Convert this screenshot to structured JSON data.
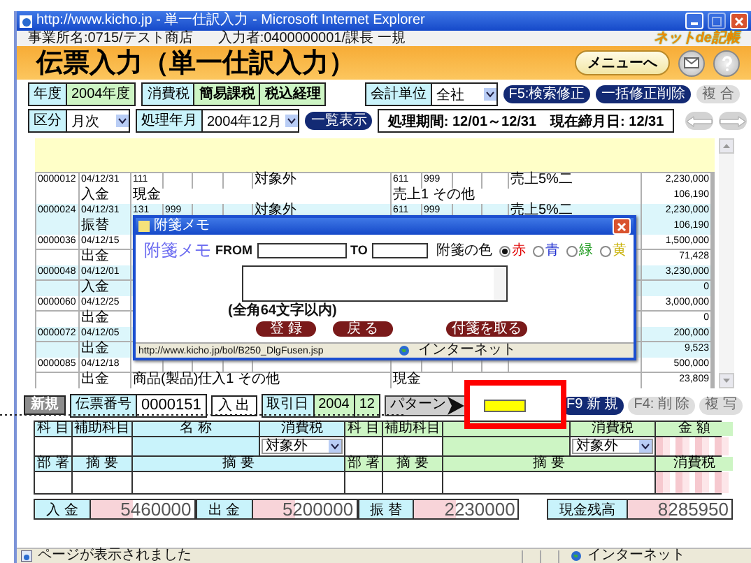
{
  "window": {
    "title": "http://www.kicho.jp - 単一仕訳入力 - Microsoft Internet Explorer"
  },
  "info": {
    "office": "事業所名:0715/テスト商店",
    "user": "入力者:0400000001/課長 一規",
    "logo": "ネットde記帳"
  },
  "header": {
    "title": "伝票入力（単一仕訳入力）",
    "menu_button": "メニューへ"
  },
  "settings_row": {
    "year_label": "年度",
    "year": "2004年度",
    "tax_label": "消費税",
    "tax_method": "簡易課税",
    "tax_accounting": "税込経理",
    "unit_label": "会計単位",
    "unit": "全社",
    "buttons": [
      {
        "label": "F5:検索修正",
        "disabled": false
      },
      {
        "label": "一括修正削除",
        "disabled": false
      },
      {
        "label": "複 合",
        "disabled": true
      }
    ]
  },
  "period_row": {
    "type_label": "区分",
    "type": "月次",
    "month_label": "処理年月",
    "month": "2004年12月",
    "list_button": "一覧表示",
    "period": "処理期間: 12/01～12/31　現在締月日: 12/31",
    "nav": [
      {
        "kind": "prev",
        "disabled": true
      },
      {
        "kind": "next",
        "disabled": true
      }
    ]
  },
  "records": [
    {
      "number": "0000012",
      "date": "04/12/31",
      "type": "入金",
      "debit_code": "111",
      "debit_tax": "対象外",
      "credit_code": "611",
      "credit_sub": "999",
      "credit_tax": "売上5%二",
      "debit_account": "現金",
      "credit_account": "売上1 その他",
      "amount": "2,230,000",
      "tax_amount": "106,190"
    },
    {
      "number": "0000024",
      "date": "04/12/31",
      "type": "振替",
      "debit_code": "131",
      "debit_sub": "999",
      "debit_tax": "対象外",
      "credit_code": "611",
      "credit_sub": "999",
      "credit_tax": "売上5%二",
      "amount": "2,230,000",
      "tax_amount": "106,190"
    },
    {
      "number": "0000036",
      "date": "04/12/15",
      "type": "出金",
      "amount": "1,500,000",
      "tax_amount": "71,428"
    },
    {
      "number": "0000048",
      "date": "04/12/01",
      "type": "入金",
      "amount": "3,230,000",
      "tax_amount": "0"
    },
    {
      "number": "0000060",
      "date": "04/12/25",
      "type": "出金",
      "amount": "3,000,000",
      "tax_amount": "0"
    },
    {
      "number": "0000072",
      "date": "04/12/05",
      "type": "出金",
      "amount": "200,000",
      "tax_amount": "9,523"
    },
    {
      "number": "0000085",
      "date": "04/12/18",
      "type": "出金",
      "debit_account": "商品(製品)仕入1 その他",
      "credit_account": "現金",
      "amount": "500,000",
      "tax_amount": "23,809"
    }
  ],
  "memo_dialog": {
    "title": "附箋メモ",
    "heading": "附箋メモ",
    "from_label": "FROM",
    "to_label": "TO",
    "color_label": "附箋の色",
    "colors": [
      {
        "label": "赤",
        "color": "#e00000",
        "selected": true
      },
      {
        "label": "青",
        "color": "#2030d0",
        "selected": false
      },
      {
        "label": "緑",
        "color": "#1f9a1f",
        "selected": false
      },
      {
        "label": "黄",
        "color": "#c8b000",
        "selected": false
      }
    ],
    "note": "(全角64文字以内)",
    "buttons": [
      "登 録",
      "戻 る"
    ],
    "remove_button": "付箋を取る",
    "url": "http://www.kicho.jp/bol/B250_DlgFusen.jsp",
    "zone": "インターネット"
  },
  "entry": {
    "new_button": "新規",
    "number_label": "伝票番号",
    "number": "0000151",
    "direction": "入 出",
    "date_label": "取引日",
    "year": "2004",
    "month": "12",
    "pattern_button": "パターン",
    "buttons": [
      {
        "label": "F9 新 規",
        "disabled": false
      },
      {
        "label": "F4: 削 除",
        "disabled": true
      },
      {
        "label": "複 写",
        "disabled": true
      }
    ],
    "debit_headers": [
      "科 目",
      "補助科目",
      "名 称",
      "消費税"
    ],
    "credit_headers": [
      "科 目",
      "補助科目",
      "消費税",
      "金 額"
    ],
    "debit_tax": "対象外",
    "credit_tax": "対象外",
    "debit_headers_2": [
      "部 署",
      "摘 要",
      "摘 要"
    ],
    "credit_headers_2": [
      "部 署",
      "摘 要",
      "摘 要",
      "消費税"
    ]
  },
  "totals": [
    {
      "label": "入 金",
      "value": "5460000"
    },
    {
      "label": "出 金",
      "value": "5200000"
    },
    {
      "label": "振 替",
      "value": "2230000"
    },
    {
      "label": "現金残高",
      "value": "8285950"
    }
  ],
  "status_bar": {
    "message": "ページが表示されました",
    "zone": "インターネット"
  }
}
